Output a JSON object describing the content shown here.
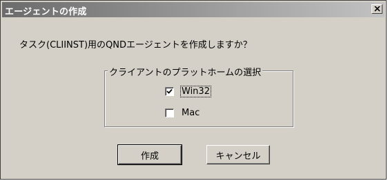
{
  "window": {
    "title": "エージェントの作成",
    "close_icon": "close-icon"
  },
  "prompt": "タスク(CLIINST)用のQNDエージェントを作成しますか？",
  "platform_group": {
    "label": "クライアントのプラットホームの選択",
    "options": [
      {
        "label": "Win32",
        "checked": true
      },
      {
        "label": "Mac",
        "checked": false
      }
    ]
  },
  "buttons": {
    "create": "作成",
    "cancel": "キャンセル"
  }
}
